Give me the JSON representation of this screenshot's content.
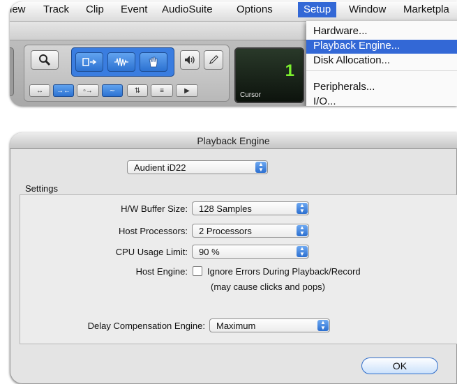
{
  "menubar": {
    "items": [
      "iew",
      "Track",
      "Clip",
      "Event",
      "AudioSuite",
      "Options",
      "Setup",
      "Window",
      "Marketpla"
    ],
    "active_item": "Setup"
  },
  "setup_menu": {
    "items": [
      "Hardware...",
      "Playback Engine...",
      "Disk Allocation...",
      "Peripherals...",
      "I/O..."
    ],
    "highlighted": "Playback Engine..."
  },
  "counter": {
    "value": "1",
    "label": "Cursor"
  },
  "dialog": {
    "title": "Playback Engine",
    "device": "Audient iD22",
    "settings_label": "Settings",
    "hw_buffer_label": "H/W Buffer Size:",
    "hw_buffer_value": "128 Samples",
    "host_processors_label": "Host Processors:",
    "host_processors_value": "2 Processors",
    "cpu_limit_label": "CPU Usage Limit:",
    "cpu_limit_value": "90 %",
    "host_engine_label": "Host Engine:",
    "ignore_errors_label": "Ignore Errors During Playback/Record",
    "ignore_errors_checked": false,
    "ignore_errors_note": "(may cause clicks and pops)",
    "delay_comp_label": "Delay Compensation Engine:",
    "delay_comp_value": "Maximum",
    "ok_label": "OK"
  },
  "colors": {
    "menu_highlight": "#3368d6",
    "counter_text": "#7cf12e",
    "popup_arrow": "#2c6fd0"
  }
}
